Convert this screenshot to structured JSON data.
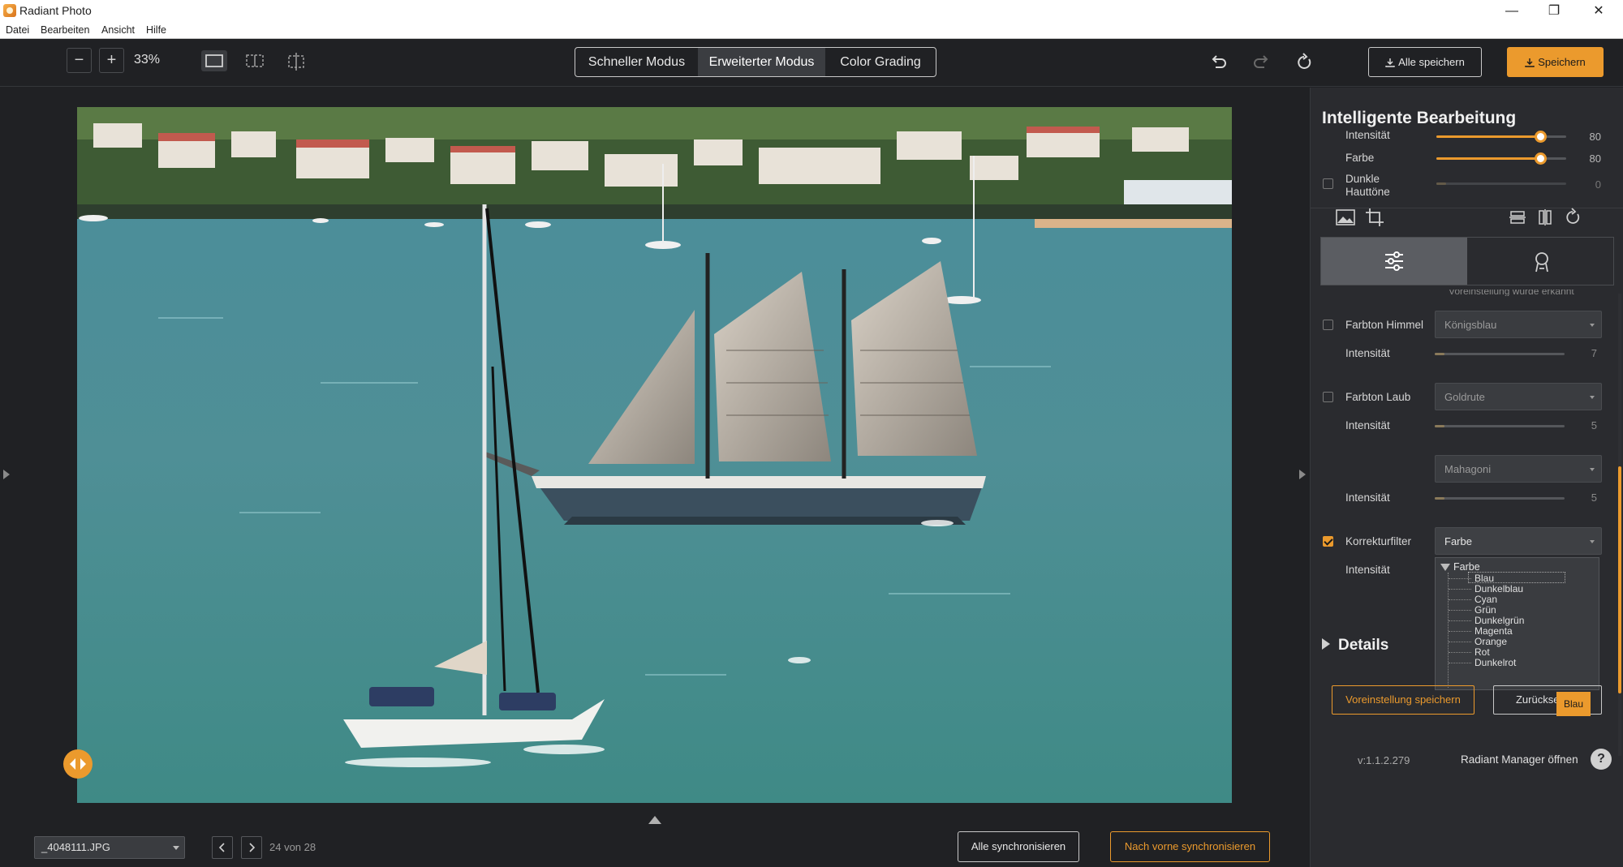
{
  "window": {
    "title": "Radiant Photo"
  },
  "menu": [
    "Datei",
    "Bearbeiten",
    "Ansicht",
    "Hilfe"
  ],
  "toolbar": {
    "zoom": "33%",
    "modes": [
      "Schneller Modus",
      "Erweiterter Modus",
      "Color Grading"
    ],
    "active_mode": "Erweiterter Modus",
    "save_all": "Alle speichern",
    "save": "Speichern"
  },
  "canvas": {
    "filename": "_4048111.JPG",
    "page": "24 von 28",
    "sync_all": "Alle synchronisieren",
    "sync_front": "Nach vorne synchronisieren"
  },
  "panel": {
    "title": "Intelligente Bearbeitung",
    "smart_sliders": [
      {
        "label": "Intensität",
        "value": 80,
        "max": 100
      },
      {
        "label": "Farbe",
        "value": 80,
        "max": 100
      },
      {
        "label": "Dunkle Hauttöne",
        "value": 0,
        "max": 100,
        "checkbox": false
      }
    ],
    "clipped_text": "Voreinstellung wurde erkannt",
    "rows": {
      "sky_label": "Farbton Himmel",
      "sky_value": "Königsblau",
      "sky_intensity_label": "Intensität",
      "sky_intensity": 7,
      "foliage_label": "Farbton Laub",
      "foliage_value": "Goldrute",
      "foliage_intensity_label": "Intensität",
      "foliage_intensity": 5,
      "third_value": "Mahagoni",
      "third_intensity_label": "Intensität",
      "third_intensity": 5,
      "filter_label": "Korrekturfilter",
      "filter_value": "Farbe",
      "filter_checked": true,
      "filter_intensity_label": "Intensität"
    },
    "dropdown_tree": {
      "group": "Farbe",
      "items": [
        "Blau",
        "Dunkelblau",
        "Cyan",
        "Grün",
        "Dunkelgrün",
        "Magenta",
        "Orange",
        "Rot",
        "Dunkelrot"
      ],
      "selected": "Blau"
    },
    "tooltip": "Blau",
    "details": "Details",
    "save_preset": "Voreinstellung speichern",
    "reset": "Zurücksetzen",
    "version": "v:1.1.2.279",
    "manager": "Radiant Manager öffnen",
    "help": "?"
  },
  "colors": {
    "accent": "#eb9a2d",
    "background": "#202124",
    "panel": "#2a2b2f"
  }
}
